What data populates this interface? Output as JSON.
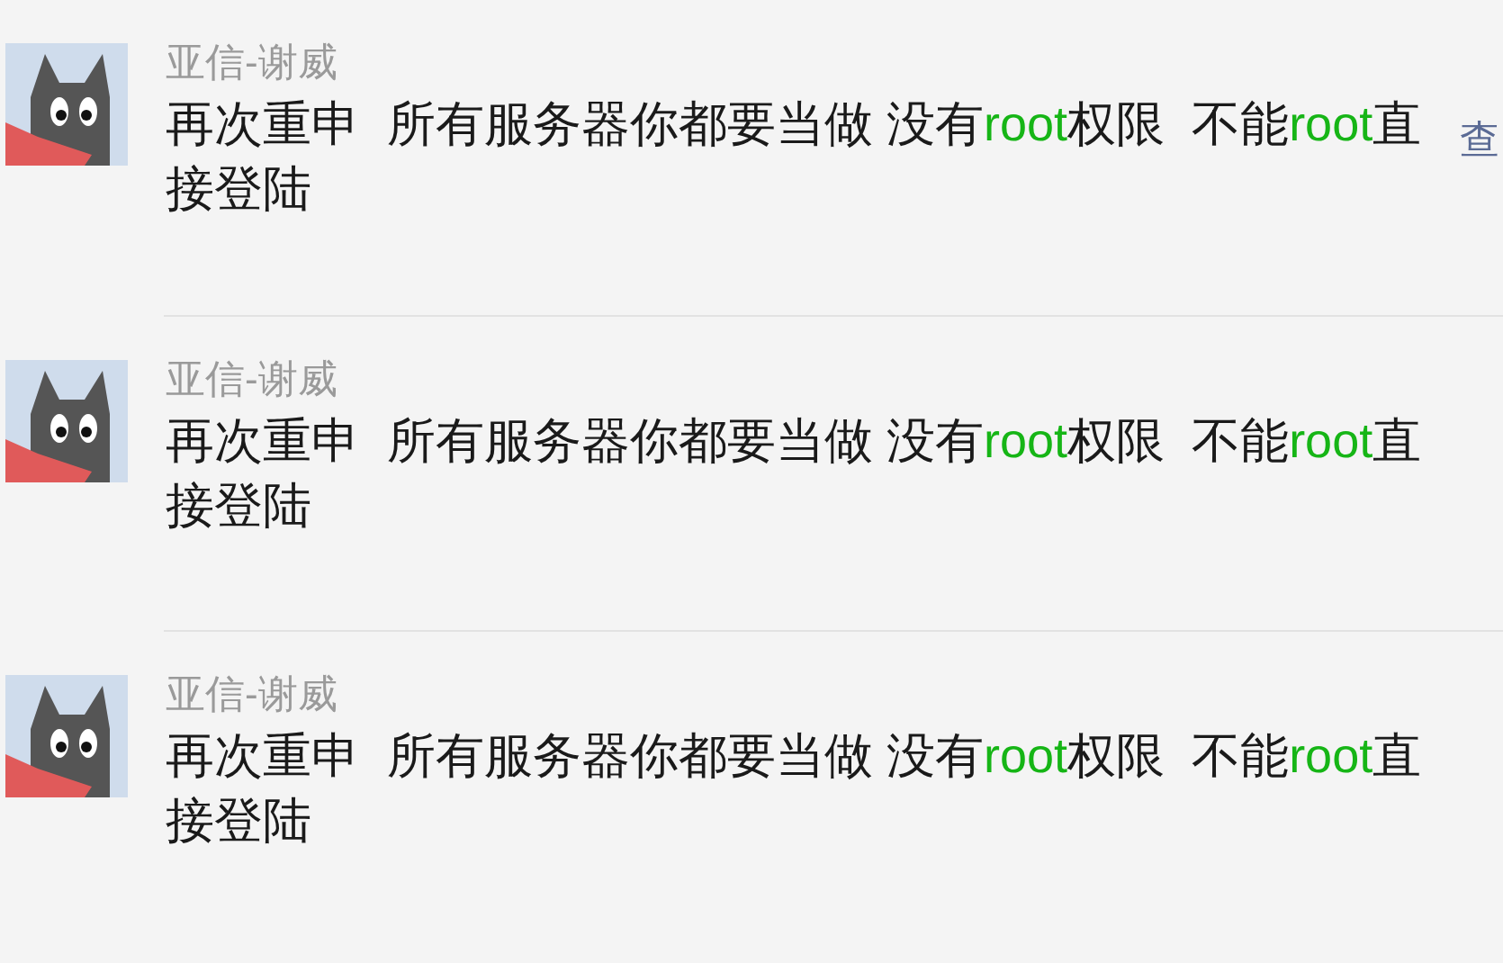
{
  "messages": [
    {
      "sender": "亚信-谢威",
      "segments": [
        {
          "text": "再次重申  所有服务器你都要当做 没有",
          "highlight": false
        },
        {
          "text": "root",
          "highlight": true
        },
        {
          "text": "权限  不能",
          "highlight": false
        },
        {
          "text": "root",
          "highlight": true
        },
        {
          "text": "直接登陆",
          "highlight": false
        }
      ],
      "link": "查"
    },
    {
      "sender": "亚信-谢威",
      "segments": [
        {
          "text": "再次重申  所有服务器你都要当做 没有",
          "highlight": false
        },
        {
          "text": "root",
          "highlight": true
        },
        {
          "text": "权限  不能",
          "highlight": false
        },
        {
          "text": "root",
          "highlight": true
        },
        {
          "text": "直接登陆",
          "highlight": false
        }
      ]
    },
    {
      "sender": "亚信-谢威",
      "segments": [
        {
          "text": "再次重申  所有服务器你都要当做 没有",
          "highlight": false
        },
        {
          "text": "root",
          "highlight": true
        },
        {
          "text": "权限  不能",
          "highlight": false
        },
        {
          "text": "root",
          "highlight": true
        },
        {
          "text": "直接登陆",
          "highlight": false
        }
      ]
    }
  ]
}
